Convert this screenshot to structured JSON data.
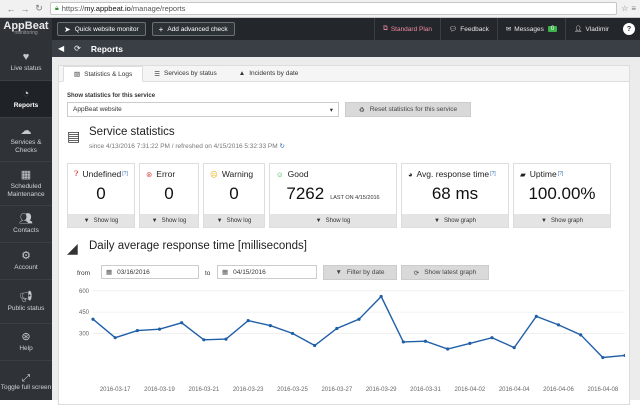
{
  "browser": {
    "url_prefix": "https://",
    "url_domain": "my.appbeat.io",
    "url_path": "/manage/reports"
  },
  "sidebar": {
    "logo": "AppBeat",
    "logo_sub": "monitoring",
    "items": [
      {
        "label": "Live status",
        "icon": "heartbeat-icon"
      },
      {
        "label": "Reports",
        "icon": "pie-chart-icon"
      },
      {
        "label": "Services & Checks",
        "icon": "cloud-icon"
      },
      {
        "label": "Scheduled Maintenance",
        "icon": "calendar-icon"
      },
      {
        "label": "Contacts",
        "icon": "users-icon"
      },
      {
        "label": "Account",
        "icon": "gears-icon"
      },
      {
        "label": "Public status",
        "icon": "bullhorn-icon"
      },
      {
        "label": "Help",
        "icon": "lifebuoy-icon"
      }
    ],
    "bottom": "Toggle full screen"
  },
  "topbar": {
    "quick": "Quick website monitor",
    "advanced": "Add advanced check",
    "plan": "Standard Plan",
    "feedback": "Feedback",
    "messages": "Messages",
    "messages_count": "0",
    "user": "Vladimir",
    "help": "?"
  },
  "page": {
    "title": "Reports"
  },
  "tabs": [
    "Statistics & Logs",
    "Services by status",
    "Incidents by date"
  ],
  "service_select": {
    "label": "Show statistics for this service",
    "value": "AppBeat website",
    "reset": "Reset statistics for this service"
  },
  "stats_section": {
    "title": "Service statistics",
    "subtitle": "since 4/13/2016 7:31:22 PM / refreshed on 4/15/2016 5:32:33 PM"
  },
  "stats": [
    {
      "name": "Undefined",
      "sup": "[?]",
      "value": "0",
      "footer": "Show log",
      "color": "#d9534f"
    },
    {
      "name": "Error",
      "sup": "",
      "value": "0",
      "footer": "Show log",
      "color": "#d9534f"
    },
    {
      "name": "Warning",
      "sup": "",
      "value": "0",
      "footer": "Show log",
      "color": "#e6a800"
    },
    {
      "name": "Good",
      "sup": "",
      "value": "7262",
      "last": "LAST ON 4/15/2016",
      "footer": "Show log",
      "color": "#3cb44b"
    },
    {
      "name": "Avg. response time",
      "sup": "[?]",
      "value": "68 ms",
      "footer": "Show graph",
      "color": "#333333"
    },
    {
      "name": "Uptime",
      "sup": "[?]",
      "value": "100.00%",
      "footer": "Show graph",
      "color": "#333333"
    }
  ],
  "chart_section": {
    "title": "Daily average response time [milliseconds]",
    "from_label": "from",
    "from_value": "03/16/2016",
    "to_label": "to",
    "to_value": "04/15/2016",
    "filter": "Filter by date",
    "latest": "Show latest graph"
  },
  "chart_data": {
    "type": "line",
    "title": "Daily average response time [milliseconds]",
    "color": "#1f5fa8",
    "ylim": [
      0,
      620
    ],
    "yticks": [
      300,
      450,
      600
    ],
    "xtick_labels": [
      "2016-03-17",
      "2016-03-19",
      "2016-03-21",
      "2016-03-23",
      "2016-03-25",
      "2016-03-27",
      "2016-03-29",
      "2016-03-31",
      "2016-04-02",
      "2016-04-04",
      "2016-04-06",
      "2016-04-08"
    ],
    "x": [
      "2016-03-16",
      "2016-03-17",
      "2016-03-18",
      "2016-03-19",
      "2016-03-20",
      "2016-03-21",
      "2016-03-22",
      "2016-03-23",
      "2016-03-24",
      "2016-03-25",
      "2016-03-26",
      "2016-03-27",
      "2016-03-28",
      "2016-03-29",
      "2016-03-30",
      "2016-03-31",
      "2016-04-01",
      "2016-04-02",
      "2016-04-03",
      "2016-04-04",
      "2016-04-05",
      "2016-04-06",
      "2016-04-07",
      "2016-04-08",
      "2016-04-09"
    ],
    "values": [
      400,
      270,
      320,
      330,
      375,
      255,
      260,
      390,
      355,
      300,
      215,
      335,
      400,
      560,
      240,
      245,
      190,
      230,
      270,
      200,
      420,
      360,
      290,
      130,
      145
    ]
  }
}
